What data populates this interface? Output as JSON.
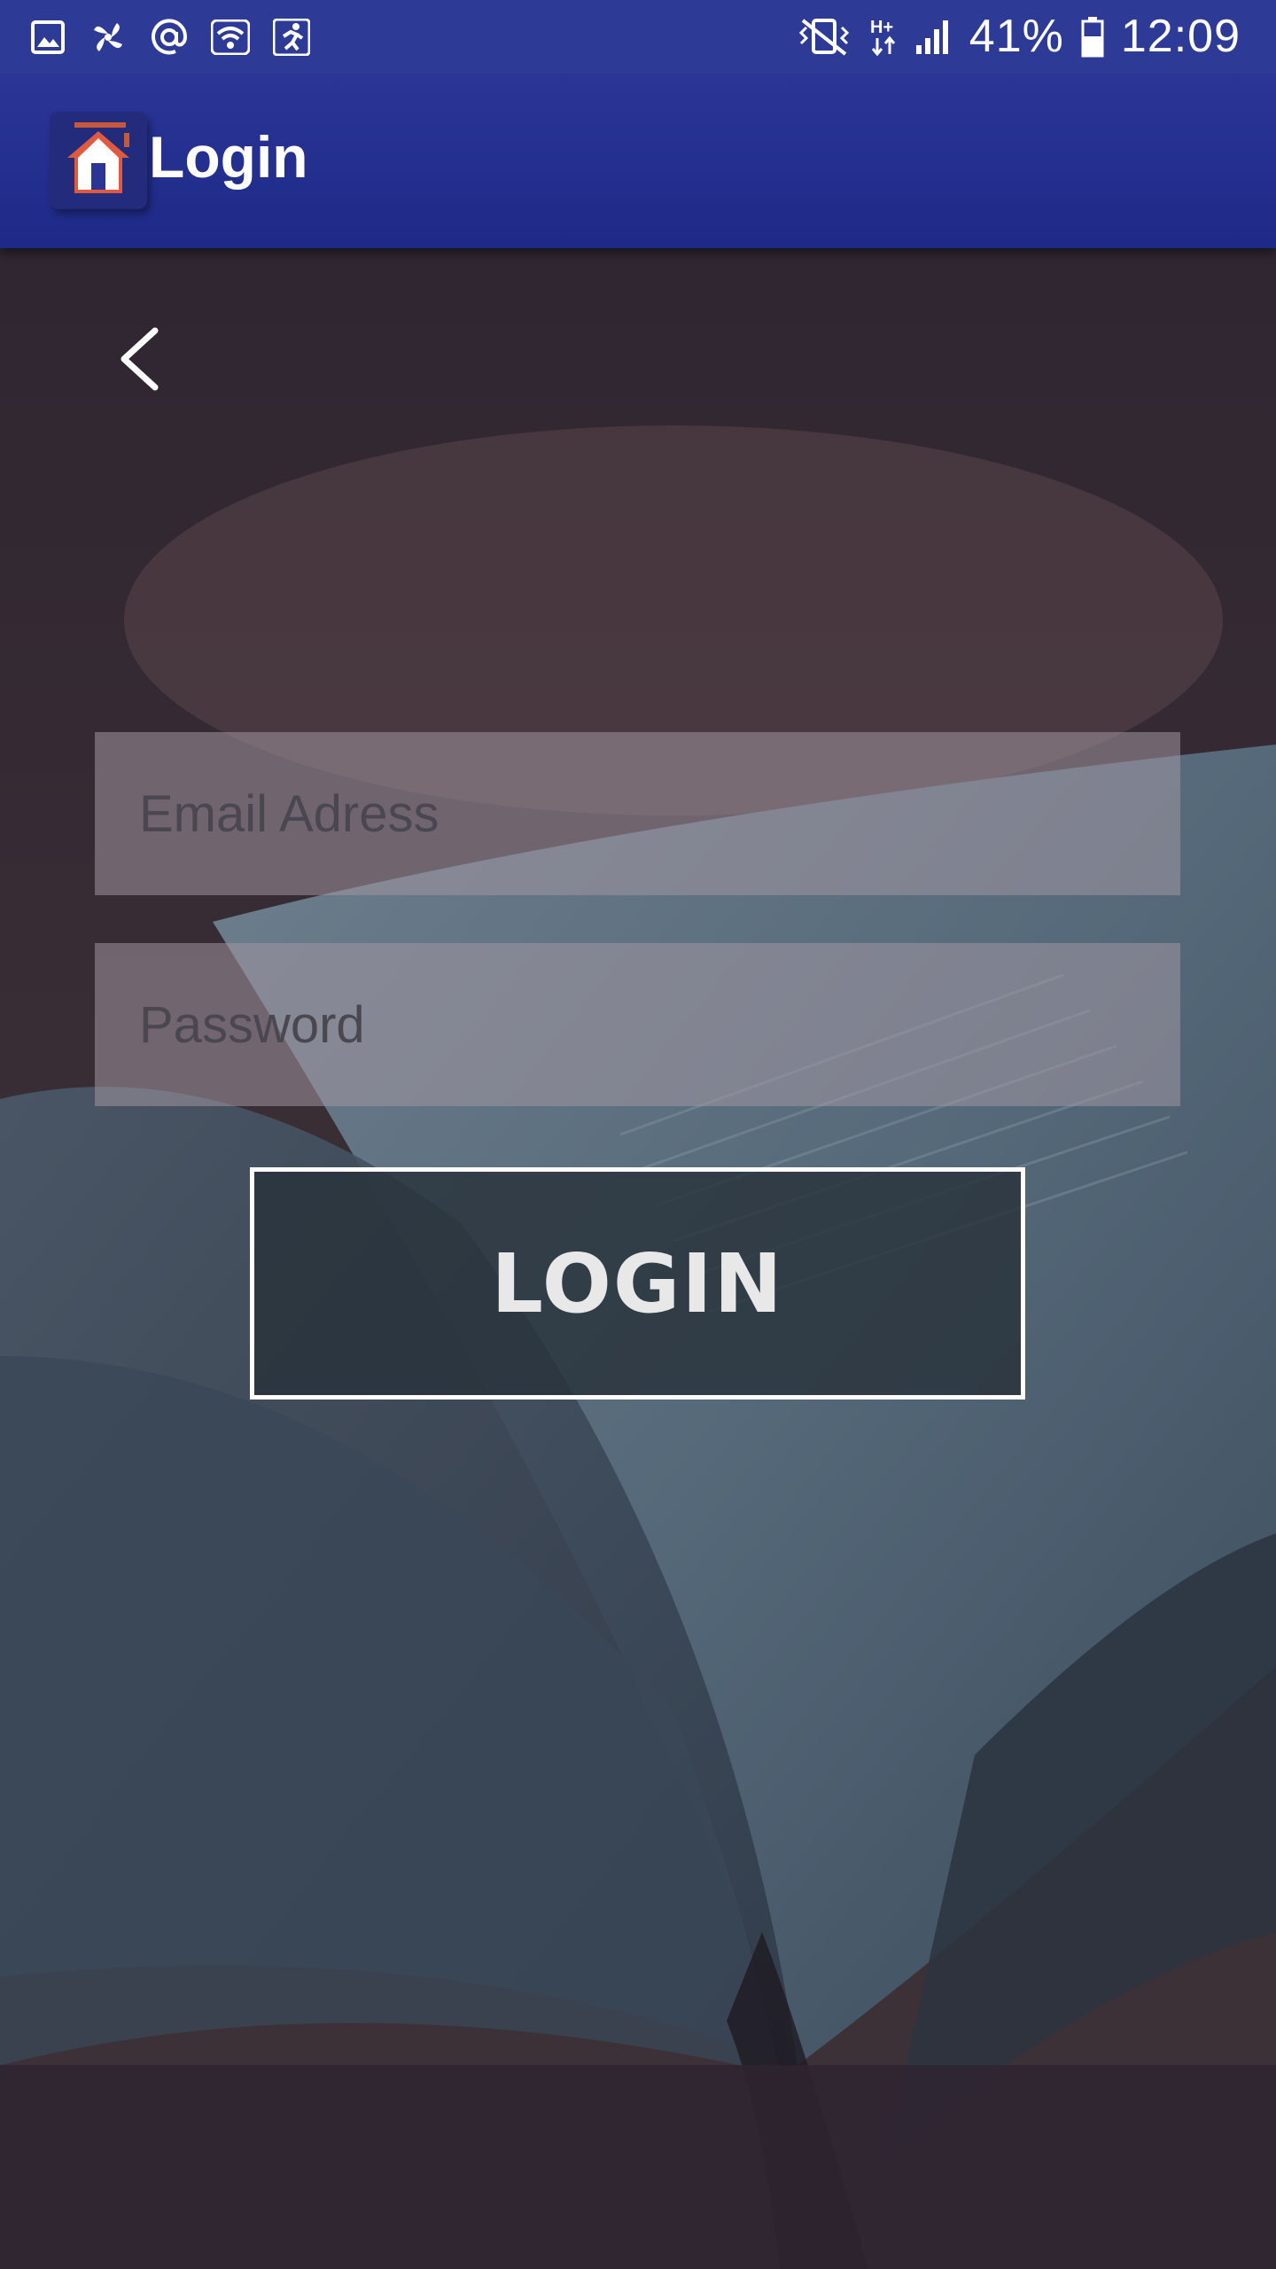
{
  "status_bar": {
    "battery": "41%",
    "time": "12:09",
    "left_icons": [
      "gallery-icon",
      "pinwheel-icon",
      "at-sign-icon",
      "wifi-icon",
      "running-person-icon"
    ],
    "right_icons": [
      "vibrate-mute-icon",
      "hplus-data-icon",
      "signal-icon",
      "battery-icon"
    ]
  },
  "app_bar": {
    "title": "Login",
    "logo_icon": "house-logo-icon"
  },
  "form": {
    "back_icon": "chevron-left-icon",
    "email_placeholder": "Email Adress",
    "email_value": "",
    "password_placeholder": "Password",
    "password_value": "",
    "login_label": "LOGIN"
  },
  "colors": {
    "status_bar": "#2d3b97",
    "app_bar": "#1e2a87",
    "field_bg": "#8f8590",
    "button_border": "#ffffff"
  }
}
